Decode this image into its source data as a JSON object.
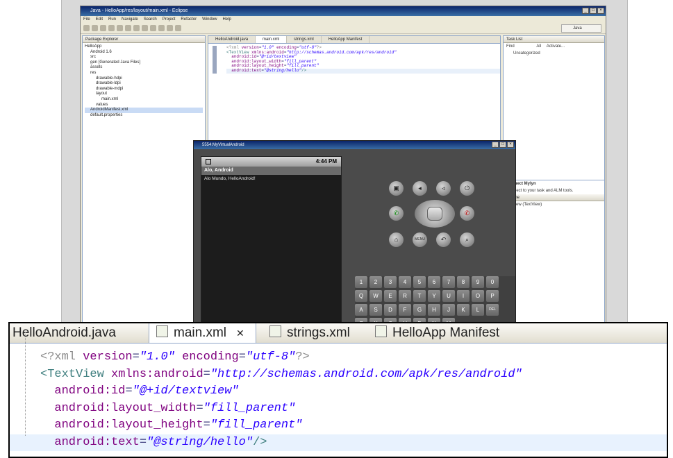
{
  "eclipse": {
    "title": "Java - HelloApp/res/layout/main.xml - Eclipse",
    "menu": [
      "File",
      "Edit",
      "Run",
      "Navigate",
      "Search",
      "Project",
      "Refactor",
      "Window",
      "Help"
    ],
    "perspective": "Java",
    "package_explorer": {
      "tab": "Package Explorer",
      "tree": [
        "HelloApp",
        "Android 1.6",
        "src",
        "gen [Generated Java Files]",
        "assets",
        "res",
        "drawable-hdpi",
        "drawable-ldpi",
        "drawable-mdpi",
        "layout",
        "main.xml",
        "values",
        "AndroidManifest.xml",
        "default.properties"
      ]
    },
    "editor_tabs": [
      "HelloAndroid.java",
      "main.xml",
      "strings.xml",
      "HelloApp Manifest"
    ],
    "task_list": {
      "tab": "Task List",
      "find": "Find",
      "all": "All",
      "activate": "Activate...",
      "uncategorized": "Uncategorized"
    },
    "mylyn": {
      "title": "Connect Mylyn",
      "text": "Connect to your task and ALM tools."
    },
    "outline": {
      "tab": "Outline",
      "item": "textview (TextView)"
    }
  },
  "emulator": {
    "title": "5554:MyVirtualAndroid",
    "time": "4:44 PM",
    "app_title": "Alo, Android",
    "app_text": "Alo Mundo, HelloAndroid!",
    "keys_row1": [
      "1",
      "2",
      "3",
      "4",
      "5",
      "6",
      "7",
      "8",
      "9",
      "0"
    ],
    "keys_row2": [
      "Q",
      "W",
      "E",
      "R",
      "T",
      "Y",
      "U",
      "I",
      "O",
      "P"
    ],
    "keys_row3": [
      "A",
      "S",
      "D",
      "F",
      "G",
      "H",
      "J",
      "K",
      "L",
      "DEL"
    ],
    "keys_row4": [
      "Z",
      "X",
      "C",
      "V",
      "B",
      "N",
      "M"
    ]
  },
  "zoom": {
    "tabs": [
      "HelloAndroid.java",
      "main.xml",
      "strings.xml",
      "HelloApp Manifest"
    ],
    "code": {
      "l1_pi": "<?xml",
      "l1_a1": "version",
      "l1_v1": "\"1.0\"",
      "l1_a2": "encoding",
      "l1_v2": "\"utf-8\"",
      "l1_end": "?>",
      "l2_tag": "TextView",
      "l2_attr": "xmlns:android",
      "l2_val": "\"http://schemas.android.com/apk/res/android\"",
      "l3_attr": "android:id",
      "l3_val": "\"@+id/textview\"",
      "l4_attr": "android:layout_width",
      "l4_val": "\"fill_parent\"",
      "l5_attr": "android:layout_height",
      "l5_val": "\"fill_parent\"",
      "l6_attr": "android:text",
      "l6_val": "\"@string/hello\"",
      "l6_end": "/>"
    }
  }
}
